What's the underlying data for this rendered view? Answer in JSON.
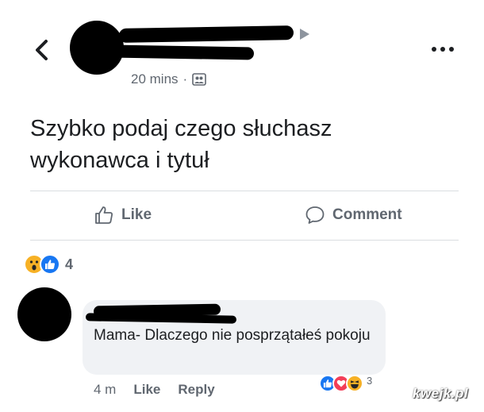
{
  "post": {
    "timestamp": "20 mins",
    "separator": "·",
    "privacy_icon": "friends-icon",
    "text_line1": "Szybko podaj czego słuchasz",
    "text_line2": "wykonawca i tytuł"
  },
  "actions": {
    "like_label": "Like",
    "comment_label": "Comment"
  },
  "reactions": {
    "icons": [
      "wow-reaction-icon",
      "like-reaction-icon"
    ],
    "count": "4"
  },
  "comment": {
    "text": "Mama- Dlaczego nie posprzątałeś pokoju",
    "time": "4 m",
    "like_label": "Like",
    "reply_label": "Reply",
    "reaction_icons": [
      "like-reaction-icon",
      "love-reaction-icon",
      "haha-reaction-icon"
    ],
    "reaction_count": "3"
  },
  "watermark": "kwejk.pl",
  "colors": {
    "text": "#1c1e21",
    "secondary": "#606770",
    "like_blue": "#1877f2",
    "love_red": "#f33e58",
    "yellow": "#f7b125",
    "bubble": "#f0f2f5"
  }
}
